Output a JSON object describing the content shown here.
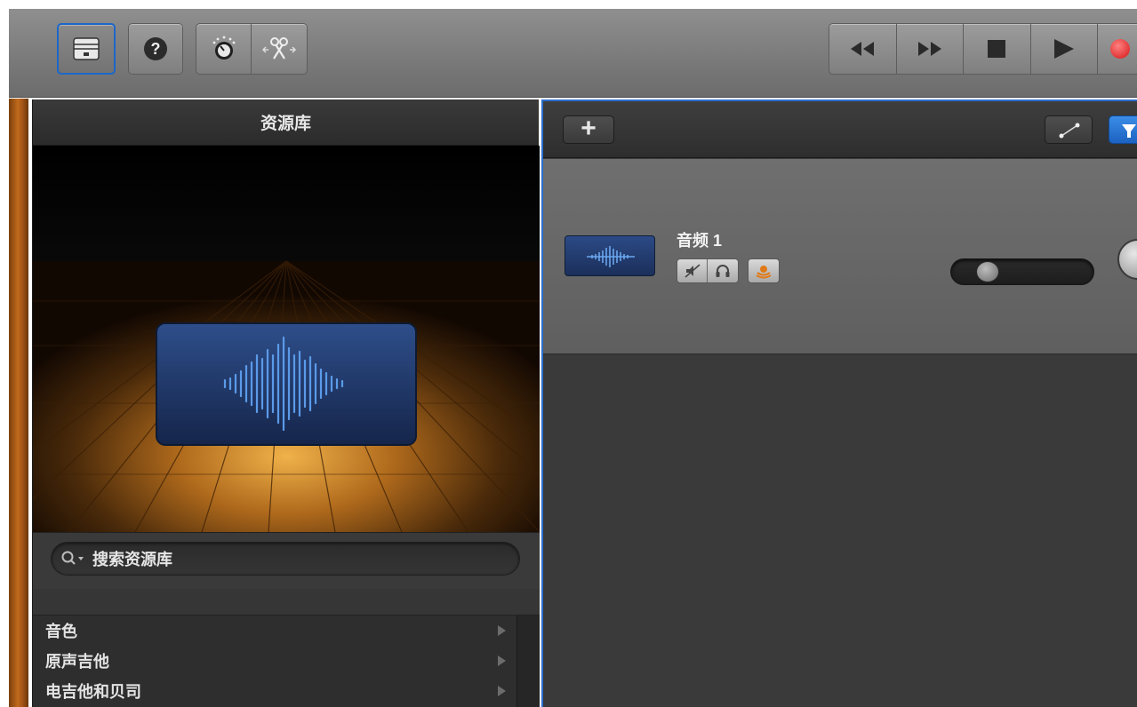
{
  "toolbar": {
    "left_buttons": [
      {
        "icon": "library-icon",
        "active": true
      },
      {
        "icon": "help-icon",
        "label": "?"
      },
      {
        "icon": "smart-controls-icon"
      },
      {
        "icon": "scissors-icon"
      }
    ],
    "transport": [
      "rewind-icon",
      "fast-forward-icon",
      "stop-icon",
      "play-icon",
      "record-icon"
    ]
  },
  "library": {
    "title": "资源库",
    "search_placeholder": "搜索资源库",
    "categories": [
      {
        "label": "音色"
      },
      {
        "label": "原声吉他"
      },
      {
        "label": "电吉他和贝司"
      }
    ]
  },
  "tracks": {
    "add_label": "+",
    "items": [
      {
        "name": "音频 1",
        "volume": 0.2
      }
    ]
  },
  "colors": {
    "accent": "#1c67c9",
    "wood": "#c06a1c",
    "audio_blue": "#4a86d8",
    "record": "#e02020"
  }
}
